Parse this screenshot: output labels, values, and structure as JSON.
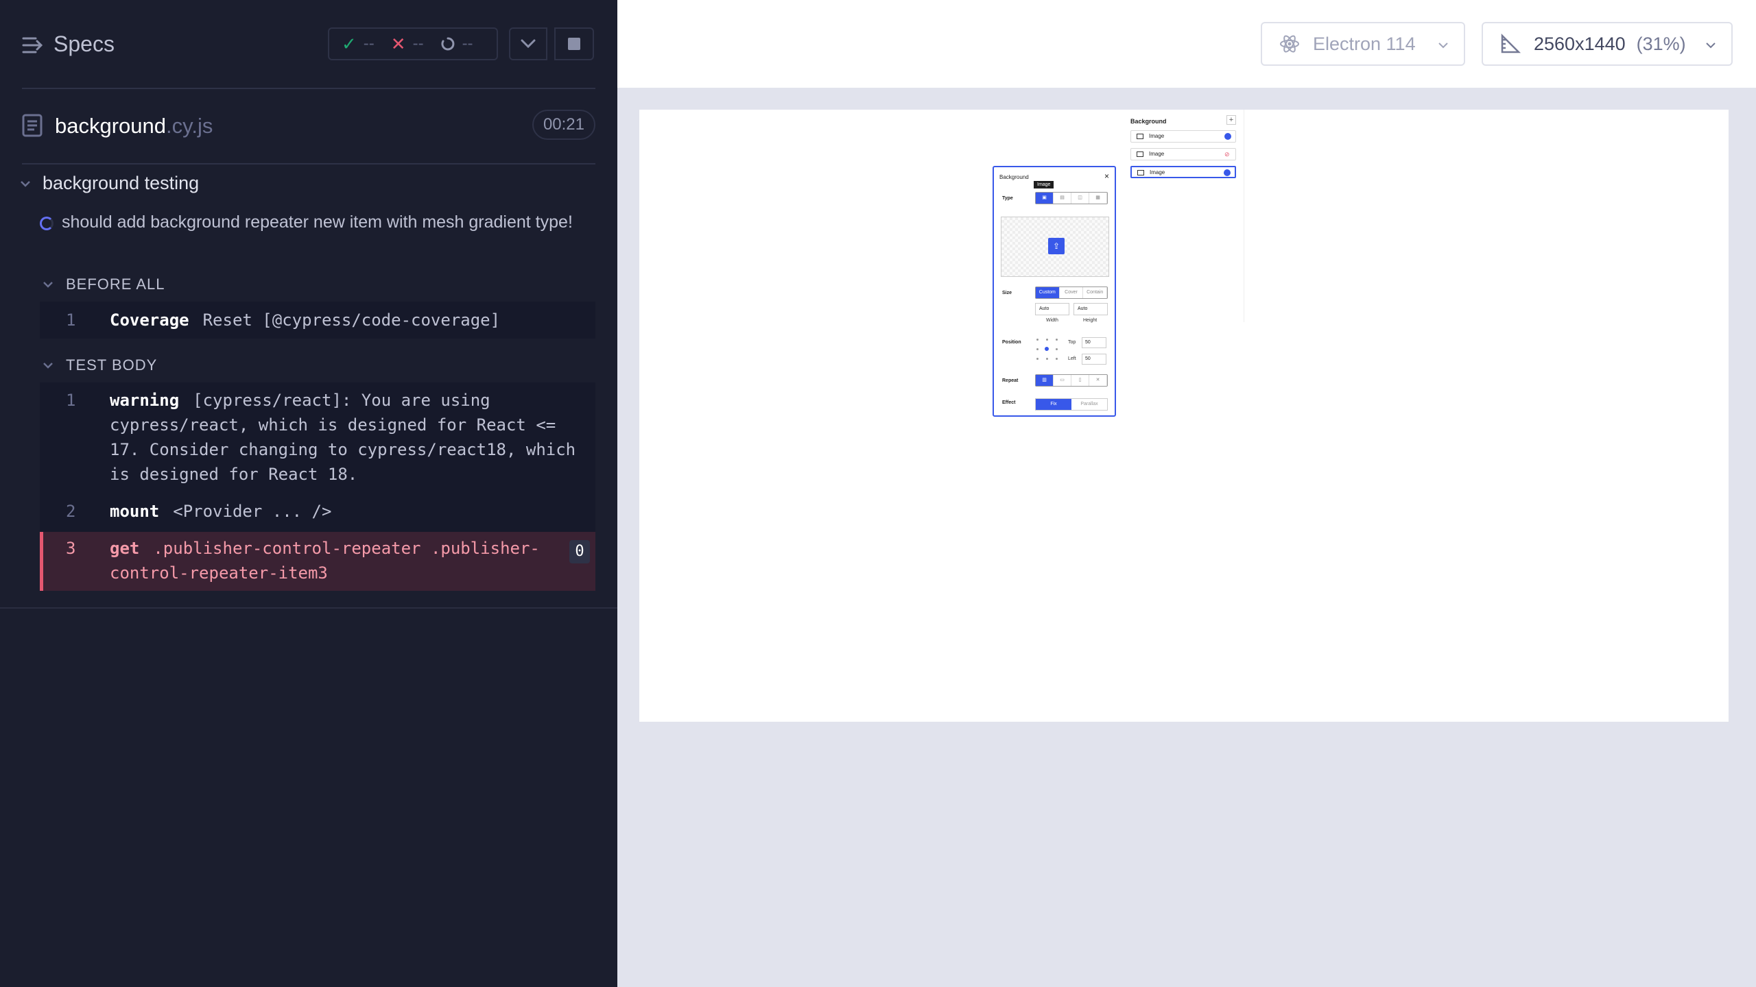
{
  "header": {
    "title": "Specs",
    "passed": "--",
    "failed": "--",
    "pending": "--"
  },
  "spec": {
    "name": "background",
    "ext": ".cy.js",
    "duration": "00:21"
  },
  "suite": {
    "title": "background testing",
    "test_title": "should add background repeater new item with mesh gradient type!"
  },
  "before_all": {
    "label": "BEFORE ALL",
    "commands": [
      {
        "num": "1",
        "name": "Coverage",
        "message": "Reset [@cypress/code-coverage]"
      }
    ]
  },
  "test_body": {
    "label": "TEST BODY",
    "commands": [
      {
        "num": "1",
        "name": "warning",
        "message": "[cypress/react]: You are using cypress/react, which is designed for React <= 17. Consider changing to cypress/react18, which is designed for React 18."
      },
      {
        "num": "2",
        "name": "mount",
        "message": "<Provider ... />"
      },
      {
        "num": "3",
        "name": "get",
        "message": ".publisher-control-repeater .publisher-control-repeater-item3",
        "count": "0",
        "state": "failed"
      }
    ]
  },
  "aut": {
    "browser": "Electron 114",
    "viewport": "2560x1440",
    "scale": "(31%)"
  },
  "mini_app": {
    "repeater_title": "Background",
    "add_symbol": "+",
    "items": [
      "Image",
      "Image",
      "Image"
    ],
    "panel_title": "Background",
    "close": "×",
    "tooltip": "Image",
    "type_label": "Type",
    "size_label": "Size",
    "size_options": [
      "Custom",
      "Cover",
      "Contain"
    ],
    "width_value": "Auto",
    "height_value": "Auto",
    "width_label": "Width",
    "height_label": "Height",
    "position_label": "Position",
    "top_label": "Top",
    "top_value": "50",
    "left_label": "Left",
    "left_value": "50",
    "unit": "%",
    "repeat_label": "Repeat",
    "effect_label": "Effect",
    "effect_options": [
      "Fix",
      "Parallax"
    ]
  },
  "colors": {
    "accent": "#3858e9",
    "pass": "#1fa971",
    "fail": "#e45770",
    "panel_bg": "#1b1e2e"
  }
}
